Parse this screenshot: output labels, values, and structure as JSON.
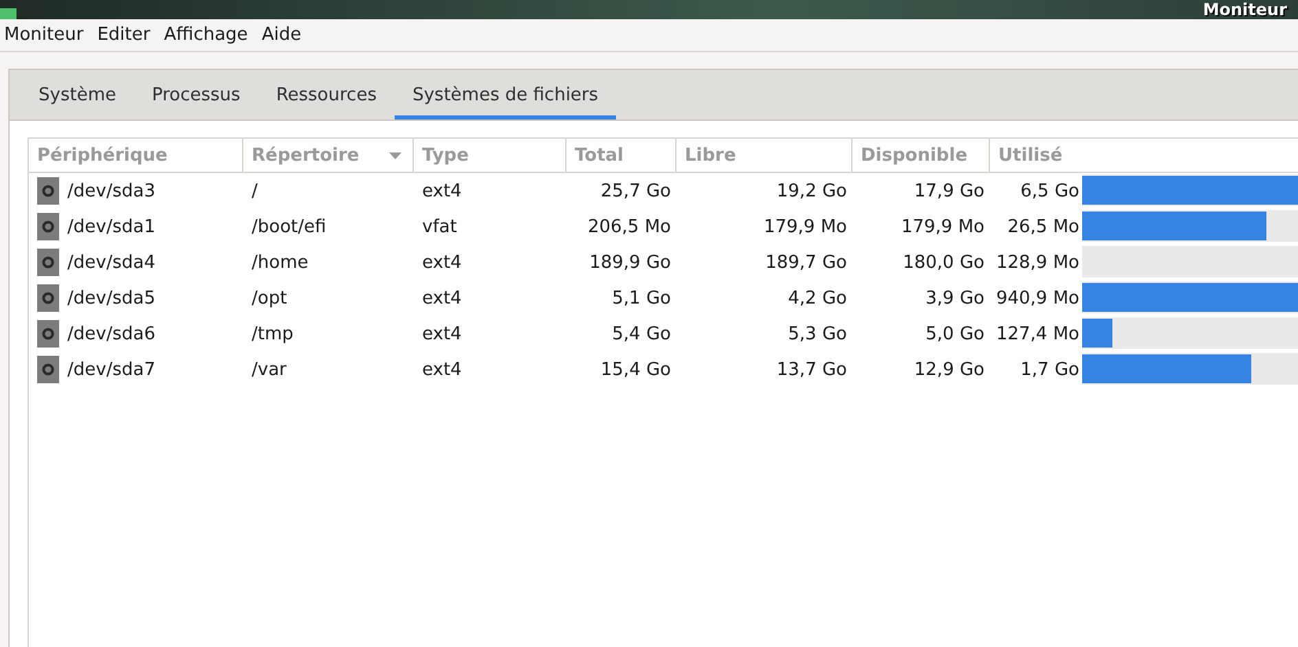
{
  "window": {
    "title": "Moniteur"
  },
  "menu": [
    "Moniteur",
    "Editer",
    "Affichage",
    "Aide"
  ],
  "tabs": [
    {
      "label": "Système",
      "selected": false
    },
    {
      "label": "Processus",
      "selected": false
    },
    {
      "label": "Ressources",
      "selected": false
    },
    {
      "label": "Systèmes de fichiers",
      "selected": true
    }
  ],
  "table": {
    "columns": [
      {
        "label": "Périphérique",
        "sorted": false
      },
      {
        "label": "Répertoire",
        "sorted": true
      },
      {
        "label": "Type",
        "sorted": false
      },
      {
        "label": "Total",
        "sorted": false
      },
      {
        "label": "Libre",
        "sorted": false
      },
      {
        "label": "Disponible",
        "sorted": false
      },
      {
        "label": "Utilisé",
        "sorted": false
      }
    ],
    "rows": [
      {
        "device": "/dev/sda3",
        "directory": "/",
        "type": "ext4",
        "total": "25,7 Go",
        "free": "19,2 Go",
        "available": "17,9 Go",
        "used": "6,5 Go",
        "level": 1.0
      },
      {
        "device": "/dev/sda1",
        "directory": "/boot/efi",
        "type": "vfat",
        "total": "206,5 Mo",
        "free": "179,9 Mo",
        "available": "179,9 Mo",
        "used": "26,5 Mo",
        "level": 0.84
      },
      {
        "device": "/dev/sda4",
        "directory": "/home",
        "type": "ext4",
        "total": "189,9 Go",
        "free": "189,7 Go",
        "available": "180,0 Go",
        "used": "128,9 Mo",
        "level": 0
      },
      {
        "device": "/dev/sda5",
        "directory": "/opt",
        "type": "ext4",
        "total": "5,1 Go",
        "free": "4,2 Go",
        "available": "3,9 Go",
        "used": "940,9 Mo",
        "level": 1.0
      },
      {
        "device": "/dev/sda6",
        "directory": "/tmp",
        "type": "ext4",
        "total": "5,4 Go",
        "free": "5,3 Go",
        "available": "5,0 Go",
        "used": "127,4 Mo",
        "level": 0.14
      },
      {
        "device": "/dev/sda7",
        "directory": "/var",
        "type": "ext4",
        "total": "15,4 Go",
        "free": "13,7 Go",
        "available": "12,9 Go",
        "used": "1,7 Go",
        "level": 0.77
      }
    ]
  }
}
